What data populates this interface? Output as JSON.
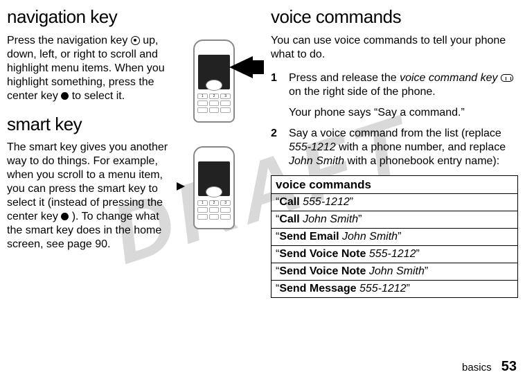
{
  "watermark": "DRAFT",
  "left": {
    "h_navkey": "navigation key",
    "nav_text_a": "Press the navigation key ",
    "nav_text_b": " up, down, left, or right to scroll and highlight menu items. When you highlight something, press the center key ",
    "nav_text_c": " to select it.",
    "h_smartkey": "smart key",
    "smart_text_a": "The smart key gives you another way to do things. For example, when you scroll to a menu item, you can press the smart key to select it (instead of pressing the center key ",
    "smart_text_b": "). To change what the smart key does in the home screen, see page 90."
  },
  "right": {
    "h_voice": "voice commands",
    "vc_intro": "You can use voice commands to tell your phone what to do.",
    "step1": {
      "num": "1",
      "a": "Press and release the ",
      "b_italic": "voice command key",
      "c": " on the right side of the phone."
    },
    "step1_follow": "Your phone says “Say a command.”",
    "step2": {
      "num": "2",
      "a": "Say a voice command from the list (replace ",
      "b_italic": "555-1212",
      "c": " with a phone number, and replace ",
      "d_italic": "John Smith",
      "e": " with a phonebook entry name):"
    },
    "table": {
      "header": "voice commands",
      "rows": [
        {
          "q1": "“",
          "bold": "Call",
          "plain": " ",
          "italic": "555-1212",
          "q2": "”"
        },
        {
          "q1": "“",
          "bold": "Call",
          "plain": " ",
          "italic": "John Smith",
          "q2": "”"
        },
        {
          "q1": "“",
          "bold": "Send Email",
          "plain": " ",
          "italic": "John Smith",
          "q2": "”"
        },
        {
          "q1": "“",
          "bold": "Send Voice Note",
          "plain": " ",
          "italic": "555-1212",
          "q2": "”"
        },
        {
          "q1": "“",
          "bold": "Send Voice Note",
          "plain": " ",
          "italic": "John Smith",
          "q2": "”"
        },
        {
          "q1": "“",
          "bold": "Send Message",
          "plain": " ",
          "italic": "555-1212",
          "q2": "”"
        }
      ]
    }
  },
  "footer": {
    "section": "basics",
    "page": "53"
  }
}
